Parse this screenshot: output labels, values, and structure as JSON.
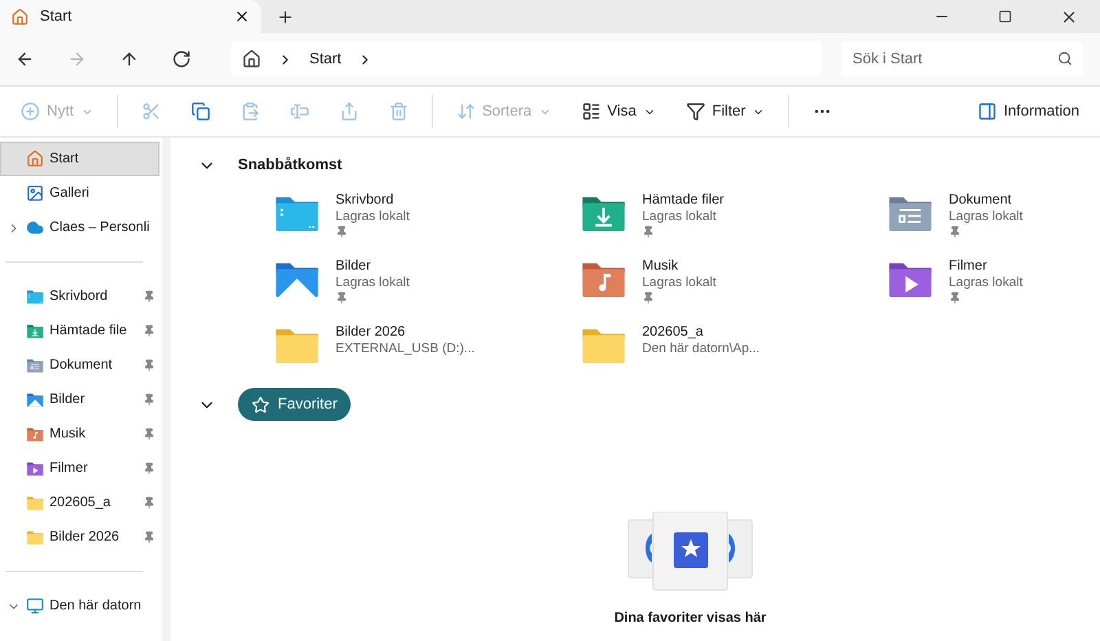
{
  "tab": {
    "title": "Start",
    "selected": true
  },
  "nav": {
    "buttons": [
      {
        "kind": "back",
        "disabled": false
      },
      {
        "kind": "forward",
        "disabled": true
      },
      {
        "kind": "up",
        "disabled": false
      },
      {
        "kind": "refresh",
        "disabled": false
      }
    ],
    "breadcrumb": [
      "Start"
    ],
    "search": {
      "placeholder": "Sök i Start"
    }
  },
  "commands": [
    {
      "kind": "new",
      "label": "Nytt",
      "disabled": true,
      "dropdown": true
    },
    {
      "kind": "cut",
      "disabled": true
    },
    {
      "kind": "copy",
      "disabled": false
    },
    {
      "kind": "paste",
      "disabled": true
    },
    {
      "kind": "rename",
      "disabled": true
    },
    {
      "kind": "share",
      "disabled": true
    },
    {
      "kind": "delete",
      "disabled": true
    },
    {
      "kind": "sort",
      "label": "Sortera",
      "disabled": true,
      "dropdown": true
    },
    {
      "kind": "view",
      "label": "Visa",
      "disabled": false,
      "dropdown": true
    },
    {
      "kind": "filter",
      "label": "Filter",
      "disabled": false,
      "dropdown": true
    },
    {
      "kind": "more",
      "disabled": false
    }
  ],
  "details_button": {
    "label": "Information"
  },
  "sidebar": {
    "groups": [
      [
        {
          "kind": "home",
          "label": "Start",
          "selected": true
        },
        {
          "kind": "gallery",
          "label": "Galleri",
          "selected": false
        },
        {
          "kind": "cloud",
          "label": "Claes – Personli",
          "selected": false,
          "expanded": false
        }
      ],
      [
        {
          "kind": "desktop",
          "label": "Skrivbord",
          "selected": false,
          "pinned": true
        },
        {
          "kind": "downloads",
          "label": "Hämtade file",
          "selected": false,
          "pinned": true
        },
        {
          "kind": "documents",
          "label": "Dokument",
          "selected": false,
          "pinned": true
        },
        {
          "kind": "pictures",
          "label": "Bilder",
          "selected": false,
          "pinned": true
        },
        {
          "kind": "music",
          "label": "Musik",
          "selected": false,
          "pinned": true
        },
        {
          "kind": "videos",
          "label": "Filmer",
          "selected": false,
          "pinned": true
        },
        {
          "kind": "folder",
          "label": "202605_a",
          "selected": false,
          "pinned": true
        },
        {
          "kind": "folder",
          "label": "Bilder 2026",
          "selected": false,
          "pinned": true
        }
      ],
      [
        {
          "kind": "pc",
          "label": "Den här datorn",
          "selected": false,
          "expanded": true
        }
      ]
    ]
  },
  "quick_access": {
    "title": "Snabbåtkomst",
    "expanded": true,
    "items": [
      {
        "kind": "desktop",
        "name": "Skrivbord",
        "location": "Lagras lokalt",
        "pinned": true
      },
      {
        "kind": "downloads",
        "name": "Hämtade filer",
        "location": "Lagras lokalt",
        "pinned": true
      },
      {
        "kind": "documents",
        "name": "Dokument",
        "location": "Lagras lokalt",
        "pinned": true
      },
      {
        "kind": "pictures",
        "name": "Bilder",
        "location": "Lagras lokalt",
        "pinned": true
      },
      {
        "kind": "music",
        "name": "Musik",
        "location": "Lagras lokalt",
        "pinned": true
      },
      {
        "kind": "videos",
        "name": "Filmer",
        "location": "Lagras lokalt",
        "pinned": true
      },
      {
        "kind": "folder",
        "name": "Bilder 2026",
        "location": "EXTERNAL_USB (D:)...",
        "pinned": false
      },
      {
        "kind": "folder",
        "name": "202605_a",
        "location": "Den här datorn\\Ap...",
        "pinned": false
      }
    ]
  },
  "favorites": {
    "title": "Favoriter",
    "expanded": true,
    "empty_message": "Dina favoriter visas här"
  }
}
